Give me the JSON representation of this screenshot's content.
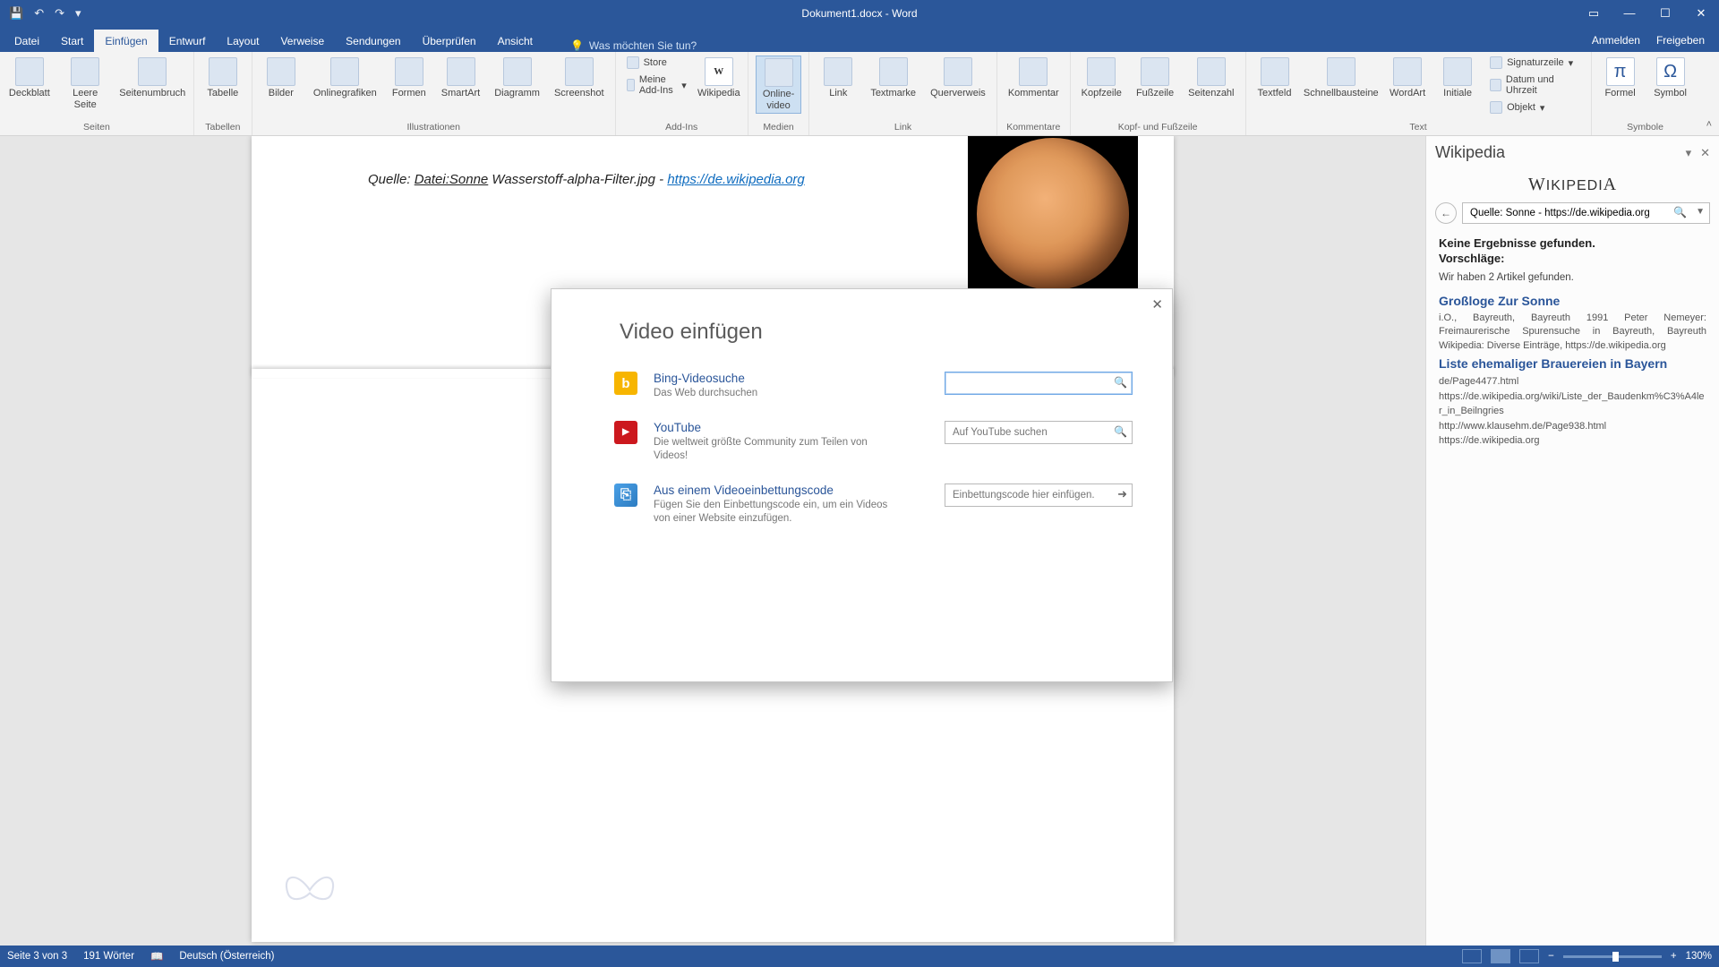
{
  "window": {
    "title": "Dokument1.docx - Word"
  },
  "qat": {
    "save": "💾",
    "undo": "↶",
    "redo": "↷",
    "more": "▾"
  },
  "win_ctrls": {
    "opts": "▭",
    "min": "—",
    "max": "☐",
    "close": "✕"
  },
  "tabs": {
    "items": [
      "Datei",
      "Start",
      "Einfügen",
      "Entwurf",
      "Layout",
      "Verweise",
      "Sendungen",
      "Überprüfen",
      "Ansicht"
    ],
    "active_index": 2,
    "tell_me_placeholder": "Was möchten Sie tun?",
    "right": {
      "signin": "Anmelden",
      "share": "Freigeben"
    }
  },
  "ribbon": {
    "groups": {
      "seiten": {
        "label": "Seiten",
        "deckblatt": "Deckblatt",
        "leere": "Leere Seite",
        "umbruch": "Seitenumbruch"
      },
      "tabellen": {
        "label": "Tabellen",
        "tabelle": "Tabelle"
      },
      "illustr": {
        "label": "Illustrationen",
        "bilder": "Bilder",
        "online": "Onlinegrafiken",
        "formen": "Formen",
        "smartart": "SmartArt",
        "diagramm": "Diagramm",
        "screenshot": "Screenshot"
      },
      "addins": {
        "label": "Add-Ins",
        "store": "Store",
        "meine": "Meine Add-Ins",
        "wikipedia": "Wikipedia"
      },
      "medien": {
        "label": "Medien",
        "onlinevideo": "Online-video"
      },
      "link": {
        "label": "Link",
        "link": "Link",
        "textmarke": "Textmarke",
        "querverweis": "Querverweis"
      },
      "kommentare": {
        "label": "Kommentare",
        "kommentar": "Kommentar"
      },
      "kopfuss": {
        "label": "Kopf- und Fußzeile",
        "kopf": "Kopfzeile",
        "fuss": "Fußzeile",
        "seitenzahl": "Seitenzahl"
      },
      "text": {
        "label": "Text",
        "textfeld": "Textfeld",
        "schnell": "Schnellbausteine",
        "wordart": "WordArt",
        "initiale": "Initiale",
        "sig": "Signaturzeile",
        "datum": "Datum und Uhrzeit",
        "objekt": "Objekt"
      },
      "symbole": {
        "label": "Symbole",
        "formel": "Formel",
        "symbol": "Symbol"
      }
    }
  },
  "document": {
    "caption_prefix": "Quelle: ",
    "caption_file": "Datei:Sonne",
    "caption_mid": " Wasserstoff-alpha-Filter.jpg - ",
    "caption_url": "https://de.wikipedia.org"
  },
  "dialog": {
    "title": "Video einfügen",
    "bing": {
      "title": "Bing-Videosuche",
      "sub": "Das Web durchsuchen",
      "placeholder": ""
    },
    "youtube": {
      "title": "YouTube",
      "sub": "Die weltweit größte Community zum Teilen von Videos!",
      "placeholder": "Auf YouTube suchen"
    },
    "embed": {
      "title": "Aus einem Videoeinbettungscode",
      "sub": "Fügen Sie den Einbettungscode ein, um ein Videos von einer Website einzufügen.",
      "placeholder": "Einbettungscode hier einfügen."
    }
  },
  "wikipedia": {
    "pane_title": "Wikipedia",
    "logo": "WIKIPEDIA",
    "search_value": "Quelle: Sonne - https://de.wikipedia.org",
    "no_results": "Keine Ergebnisse gefunden.",
    "suggestions_label": "Vorschläge:",
    "found_line": "Wir haben 2 Artikel gefunden.",
    "results": [
      {
        "title": "Großloge Zur Sonne",
        "snippet": "i.O., Bayreuth, Bayreuth 1991 Peter Nemeyer: Freimaurerische Spurensuche in Bayreuth, Bayreuth Wikipedia: Diverse Einträge, https://de.wikipedia.org"
      },
      {
        "title": "Liste ehemaliger Brauereien in Bayern",
        "links": "de/Page4477.html\nhttps://de.wikipedia.org/wiki/Liste_der_Baudenkm%C3%A4ler_in_Beilngries\nhttp://www.klausehm.de/Page938.html\nhttps://de.wikipedia.org"
      }
    ]
  },
  "statusbar": {
    "page": "Seite 3 von 3",
    "words": "191 Wörter",
    "lang": "Deutsch (Österreich)",
    "zoom": "130%"
  }
}
